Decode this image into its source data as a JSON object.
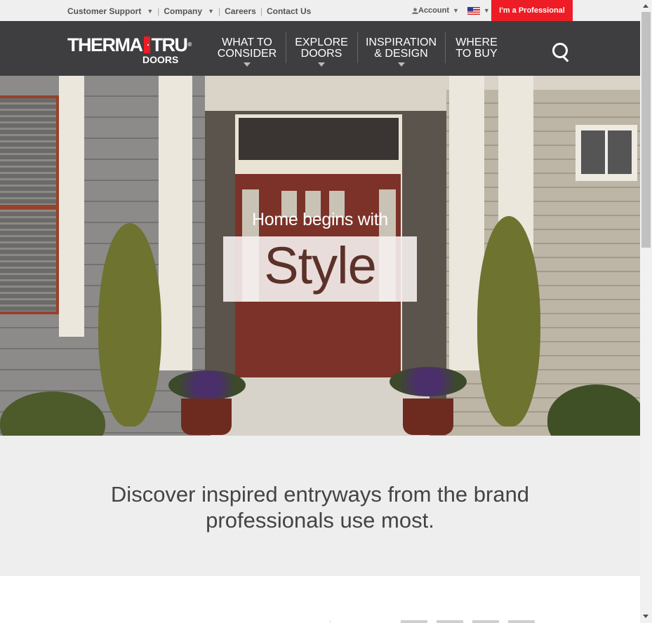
{
  "utility": {
    "links": [
      {
        "label": "Customer Support",
        "caret": "▼"
      },
      {
        "label": "Company",
        "caret": "▼"
      },
      {
        "label": "Careers"
      },
      {
        "label": "Contact Us"
      }
    ],
    "account_label": "Account",
    "account_caret": "▼",
    "flag_caret": "▼",
    "professional_label": "I'm a Professional"
  },
  "logo": {
    "word_left": "THERMA",
    "word_right": "TRU",
    "reg": "®",
    "sub": "DOORS"
  },
  "nav": {
    "items": [
      {
        "line1": "WHAT TO",
        "line2": "CONSIDER",
        "dropdown": true
      },
      {
        "line1": "EXPLORE",
        "line2": "DOORS",
        "dropdown": true
      },
      {
        "line1": "INSPIRATION",
        "line2": "& DESIGN",
        "dropdown": true
      },
      {
        "line1": "WHERE",
        "line2": "TO BUY",
        "dropdown": false
      }
    ]
  },
  "hero": {
    "tagline": "Home begins with",
    "headline": "Style"
  },
  "discover": {
    "line1": "Discover inspired entryways from the brand",
    "line2": "professionals use most."
  },
  "colors": {
    "brand_red": "#ee1c25",
    "nav_bg": "#3e3e40",
    "band_bg": "#eeeeee"
  },
  "icons": [
    "user-icon",
    "us-flag-icon",
    "search-icon"
  ]
}
